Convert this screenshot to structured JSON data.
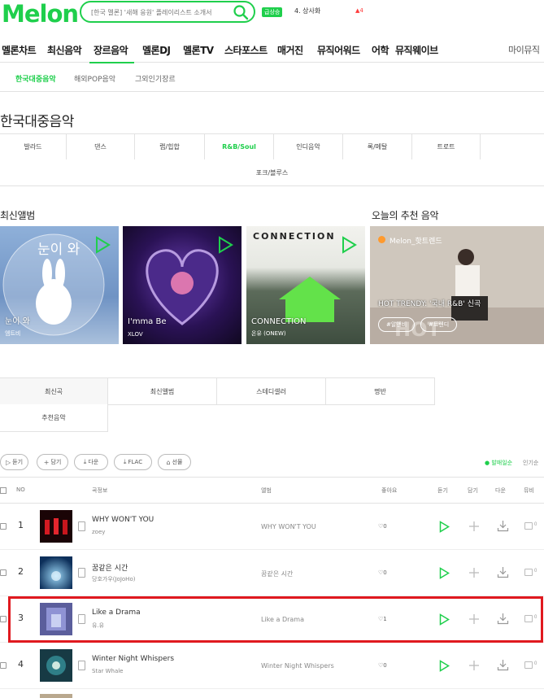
{
  "header": {
    "logo": "Melon",
    "search_placeholder": "[한국 멜론] '새해 응원' 플레이리스트 소개서",
    "realtime_badge": "급상승",
    "realtime_item": "4. 상사화",
    "realtime_rank": "▲4"
  },
  "gnb": {
    "items": [
      "멜론차트",
      "최신음악",
      "장르음악",
      "멜론DJ",
      "멜론TV",
      "스타포스트",
      "매거진",
      "뮤직어워드",
      "어학",
      "뮤직웨이브"
    ],
    "my_music": "마이뮤직"
  },
  "subnav": {
    "items": [
      "한국대중음악",
      "해외POP음악",
      "그외인기장르"
    ]
  },
  "page_title": "한국대중음악",
  "genres": [
    "발라드",
    "댄스",
    "랩/힙합",
    "R&B/Soul",
    "인디음악",
    "록/메탈",
    "트로트",
    "포크/블루스"
  ],
  "new_albums": {
    "title": "최신앨범",
    "items": [
      {
        "title": "눈이 와",
        "artist": "엠트비"
      },
      {
        "title": "I'mma Be",
        "artist": "XLOV"
      },
      {
        "title": "CONNECTION",
        "artist": "온유 (ONEW)"
      }
    ],
    "album1_overlay": "눈이 와",
    "album3_overlay": "CONNECTION"
  },
  "recommend": {
    "title": "오늘의 추천 음악",
    "channel": "Melon_핫트렌드",
    "caption": "HOT TRENDY: '국내 R&B' 신곡",
    "tags": [
      "#알앤비",
      "#트렌디"
    ]
  },
  "list_tabs": [
    "최신곡",
    "최신앨범",
    "스테디셀러",
    "명반",
    "추천음악"
  ],
  "actions": {
    "buttons": [
      "듣기",
      "담기",
      "다운",
      "FLAC",
      "선물"
    ],
    "sort_popular": "● 발매일순",
    "sort_other": "인기순"
  },
  "table": {
    "headers": [
      "NO",
      "곡정보",
      "앨범",
      "좋아요",
      "듣기",
      "담기",
      "다운",
      "뮤비"
    ],
    "rows": [
      {
        "rank": "1",
        "title": "WHY WON'T YOU",
        "artist": "zoey",
        "album": "WHY WON'T YOU",
        "likes": "0"
      },
      {
        "rank": "2",
        "title": "꿈같은 시간",
        "artist": "당호가우(JoJoHo)",
        "album": "꿈같은 시간",
        "likes": "0"
      },
      {
        "rank": "3",
        "title": "Like a Drama",
        "artist": "유.유",
        "album": "Like a Drama",
        "likes": "1"
      },
      {
        "rank": "4",
        "title": "Winter Night Whispers",
        "artist": "Star Whale",
        "album": "Winter Night Whispers",
        "likes": "0"
      }
    ],
    "mv_count": "0"
  },
  "colors": {
    "brand": "#1fcf4c",
    "highlight": "#e0191f"
  }
}
